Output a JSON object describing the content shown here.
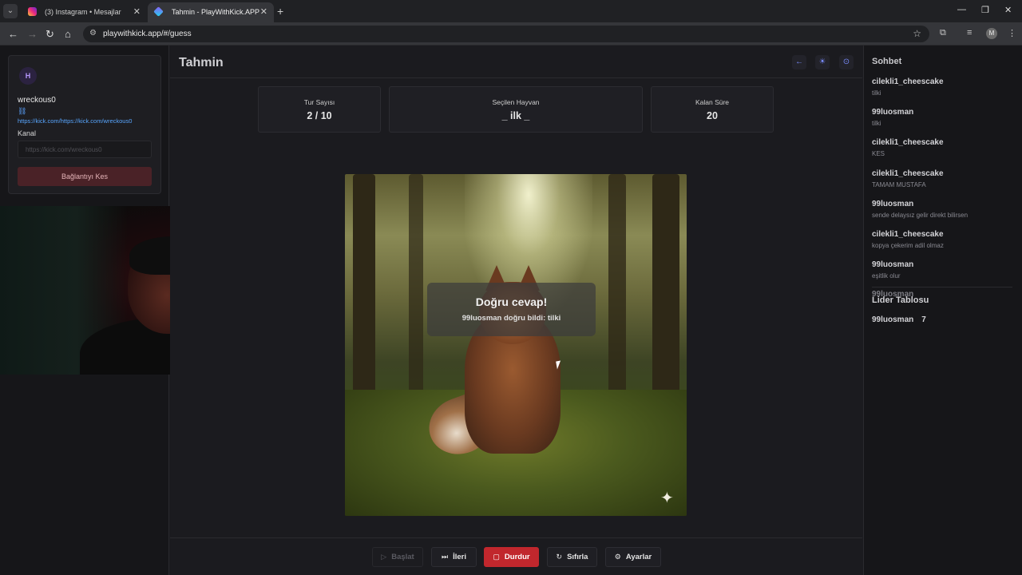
{
  "browser": {
    "tabs": [
      {
        "title": "(3) Instagram • Mesajlar",
        "active": false
      },
      {
        "title": "Tahmin - PlayWithKick.APP",
        "active": true
      }
    ],
    "url": "playwithkick.app/#/guess",
    "profile_initial": "M"
  },
  "left": {
    "avatar_initial": "H",
    "username": "wreckous0",
    "kick_url": "https://kick.com/https://kick.com/wreckous0",
    "kanal_label": "Kanal",
    "kanal_placeholder": "https://kick.com/wreckous0",
    "disconnect_label": "Bağlantıyı Kes"
  },
  "main": {
    "title": "Tahmin",
    "stats": [
      {
        "label": "Tur Sayısı",
        "value": "2 / 10"
      },
      {
        "label": "Seçilen Hayvan",
        "value": "_ ilk _"
      },
      {
        "label": "Kalan Süre",
        "value": "20"
      }
    ],
    "toast": {
      "title": "Doğru cevap!",
      "message": "99luosman doğru bildi: tilki"
    },
    "footer": {
      "start": "Başlat",
      "next": "İleri",
      "stop": "Durdur",
      "reset": "Sıfırla",
      "settings": "Ayarlar"
    }
  },
  "chat": {
    "title": "Sohbet",
    "messages": [
      {
        "user": "cilekli1_cheescake",
        "text": "tilki"
      },
      {
        "user": "99luosman",
        "text": "tilki"
      },
      {
        "user": "cilekli1_cheescake",
        "text": "KES"
      },
      {
        "user": "cilekli1_cheescake",
        "text": "TAMAM MUSTAFA"
      },
      {
        "user": "99luosman",
        "text": "sende delaysız gelir direkt bilirsen"
      },
      {
        "user": "cilekli1_cheescake",
        "text": "kopya çekerim adil olmaz"
      },
      {
        "user": "99luosman",
        "text": "eşitlik olur"
      }
    ],
    "overlap_user": "99luosman"
  },
  "leaderboard": {
    "title": "Lider Tablosu",
    "entries": [
      {
        "user": "99luosman",
        "score": "7"
      }
    ]
  },
  "colors": {
    "accent": "#7a8cff",
    "stop": "#c1272d",
    "link": "#58a6ff"
  }
}
